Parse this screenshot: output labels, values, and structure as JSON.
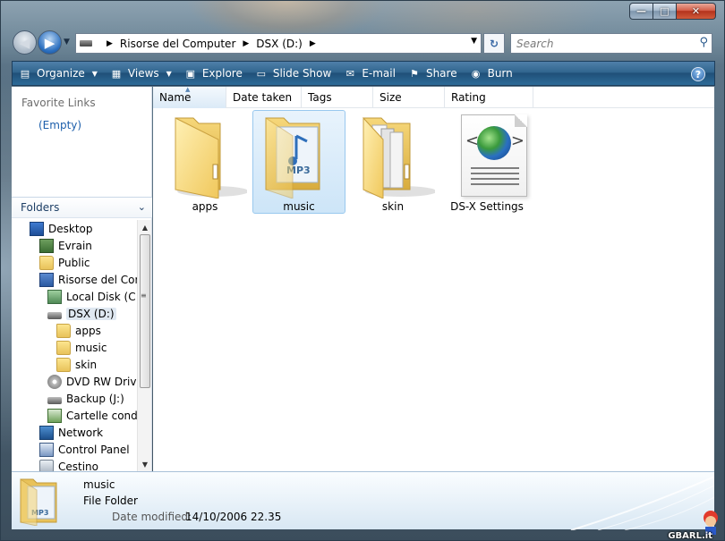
{
  "window": {
    "min_icon": "minimize-icon",
    "max_icon": "maximize-icon",
    "close_icon": "close-icon",
    "min_glyph": "—",
    "max_glyph": "□",
    "close_glyph": "✕"
  },
  "nav": {
    "back_glyph": "◀",
    "fwd_glyph": "▶",
    "history_glyph": "▼",
    "breadcrumb": [
      "Risorse del Computer",
      "DSX (D:)"
    ],
    "sep_glyph": "▶",
    "dropdown_glyph": "▼",
    "refresh_glyph": "↻",
    "search_placeholder": "Search",
    "search_glyph": "⚲"
  },
  "toolbar": {
    "items": [
      {
        "label": "Organize",
        "icon": "organize-icon",
        "glyph": "▤",
        "caret": "▼"
      },
      {
        "label": "Views",
        "icon": "views-icon",
        "glyph": "▦",
        "caret": "▼"
      },
      {
        "label": "Explore",
        "icon": "explore-icon",
        "glyph": "▣"
      },
      {
        "label": "Slide Show",
        "icon": "slideshow-icon",
        "glyph": "▭"
      },
      {
        "label": "E-mail",
        "icon": "email-icon",
        "glyph": "✉"
      },
      {
        "label": "Share",
        "icon": "share-icon",
        "glyph": "⚑"
      },
      {
        "label": "Burn",
        "icon": "burn-icon",
        "glyph": "◉"
      }
    ],
    "help_glyph": "?"
  },
  "left": {
    "favorites_header": "Favorite Links",
    "favorites_empty": "(Empty)",
    "folders_header": "Folders",
    "folders_chev": "⌄",
    "tree": [
      {
        "label": "Desktop",
        "icon": "desktop-icon",
        "indent": 0
      },
      {
        "label": "Evrain",
        "icon": "user-folder-icon",
        "indent": 1
      },
      {
        "label": "Public",
        "icon": "folder-icon",
        "indent": 1
      },
      {
        "label": "Risorse del Computer",
        "icon": "computer-icon",
        "indent": 1
      },
      {
        "label": "Local Disk (C:)",
        "icon": "local-disk-icon",
        "indent": 2
      },
      {
        "label": "DSX (D:)",
        "icon": "drive-icon",
        "indent": 2,
        "selected": true
      },
      {
        "label": "apps",
        "icon": "folder-icon",
        "indent": 3
      },
      {
        "label": "music",
        "icon": "folder-icon",
        "indent": 3
      },
      {
        "label": "skin",
        "icon": "folder-icon",
        "indent": 3
      },
      {
        "label": "DVD RW Drive",
        "icon": "dvd-icon",
        "indent": 2
      },
      {
        "label": "Backup (J:)",
        "icon": "drive-icon",
        "indent": 2
      },
      {
        "label": "Cartelle condivise",
        "icon": "shared-folders-icon",
        "indent": 2
      },
      {
        "label": "Network",
        "icon": "network-icon",
        "indent": 1
      },
      {
        "label": "Control Panel",
        "icon": "control-panel-icon",
        "indent": 1
      },
      {
        "label": "Cestino",
        "icon": "recycle-bin-icon",
        "indent": 1
      }
    ],
    "scroll_up": "▲",
    "scroll_down": "▼",
    "scroll_grip": "≡"
  },
  "columns": [
    "Name",
    "Date taken",
    "Tags",
    "Size",
    "Rating"
  ],
  "sort_glyph": "▲",
  "items": [
    {
      "label": "apps",
      "kind": "folder",
      "icon": "folder-icon"
    },
    {
      "label": "music",
      "kind": "music-folder",
      "icon": "music-folder-icon",
      "selected": true
    },
    {
      "label": "skin",
      "kind": "folder-docs",
      "icon": "folder-icon"
    },
    {
      "label": "DS-X Settings",
      "kind": "settings",
      "icon": "settings-file-icon"
    }
  ],
  "details": {
    "name": "music",
    "type": "File Folder",
    "modified_label": "Date modified:",
    "modified_value": "14/10/2006 22.35"
  },
  "watermark": "GBARL.it"
}
